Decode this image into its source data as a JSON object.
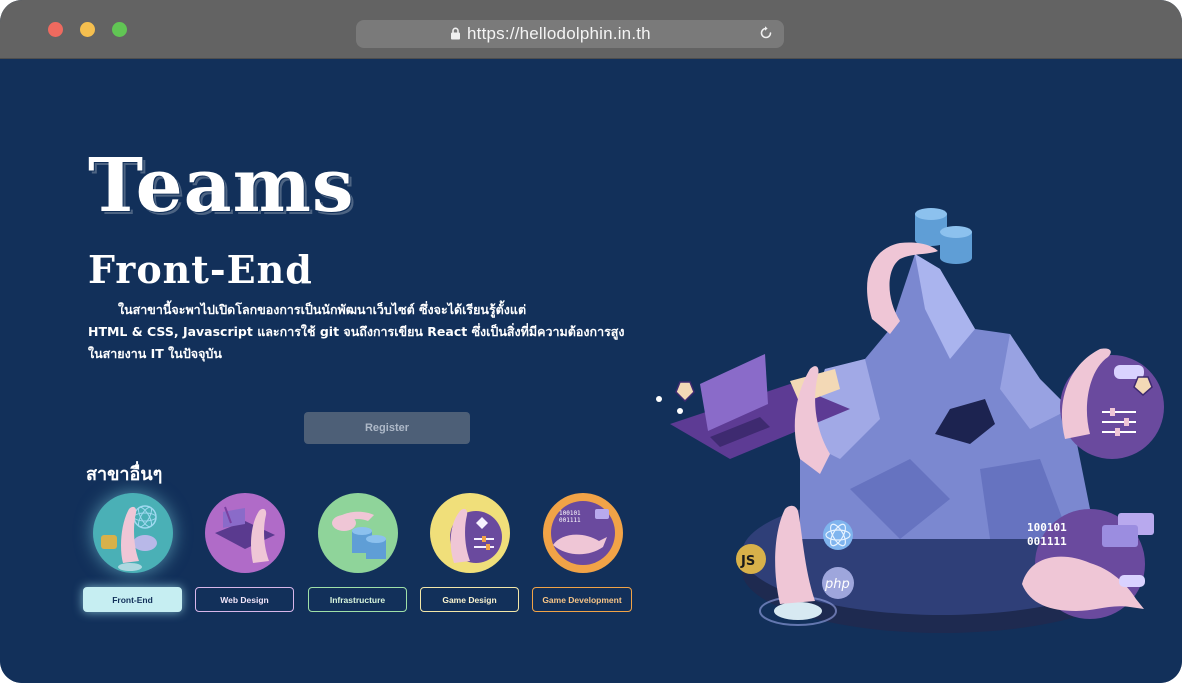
{
  "browser": {
    "url": "https://hellodolphin.in.th",
    "icons": {
      "lock": "lock-icon",
      "reload": "reload-icon"
    }
  },
  "hero": {
    "title": "Teams",
    "subtitle": "Front-End",
    "description": [
      "ในสาขานี้จะพาไปเปิดโลกของการเป็นนักพัฒนาเว็บไซต์ ซึ่งจะได้เรียนรู้ตั้งแต่",
      "HTML & CSS, Javascript และการใช้ git จนถึงการเขียน React ซึ่งเป็นสิ่งที่มีความต้องการสูง",
      "ในสายงาน IT ในปัจจุบัน"
    ],
    "register_label": "Register"
  },
  "branches": {
    "title": "สาขาอื่นๆ",
    "items": [
      {
        "label": "Front-End",
        "active": true,
        "color": "#4ab0b6"
      },
      {
        "label": "Web Design",
        "active": false,
        "color": "#b06bc8"
      },
      {
        "label": "Infrastructure",
        "active": false,
        "color": "#8fd49a"
      },
      {
        "label": "Game Design",
        "active": false,
        "color": "#f0df7a"
      },
      {
        "label": "Game Development",
        "active": false,
        "color": "#f1a347"
      }
    ]
  },
  "illustration": {
    "binary": [
      "100101",
      "001111"
    ],
    "badges": {
      "js": "JS",
      "php": "php"
    }
  },
  "colors": {
    "background": "#12305a",
    "titlebar": "#636363",
    "dolphin": "#efc6d6",
    "rock": "#7b88d0"
  }
}
